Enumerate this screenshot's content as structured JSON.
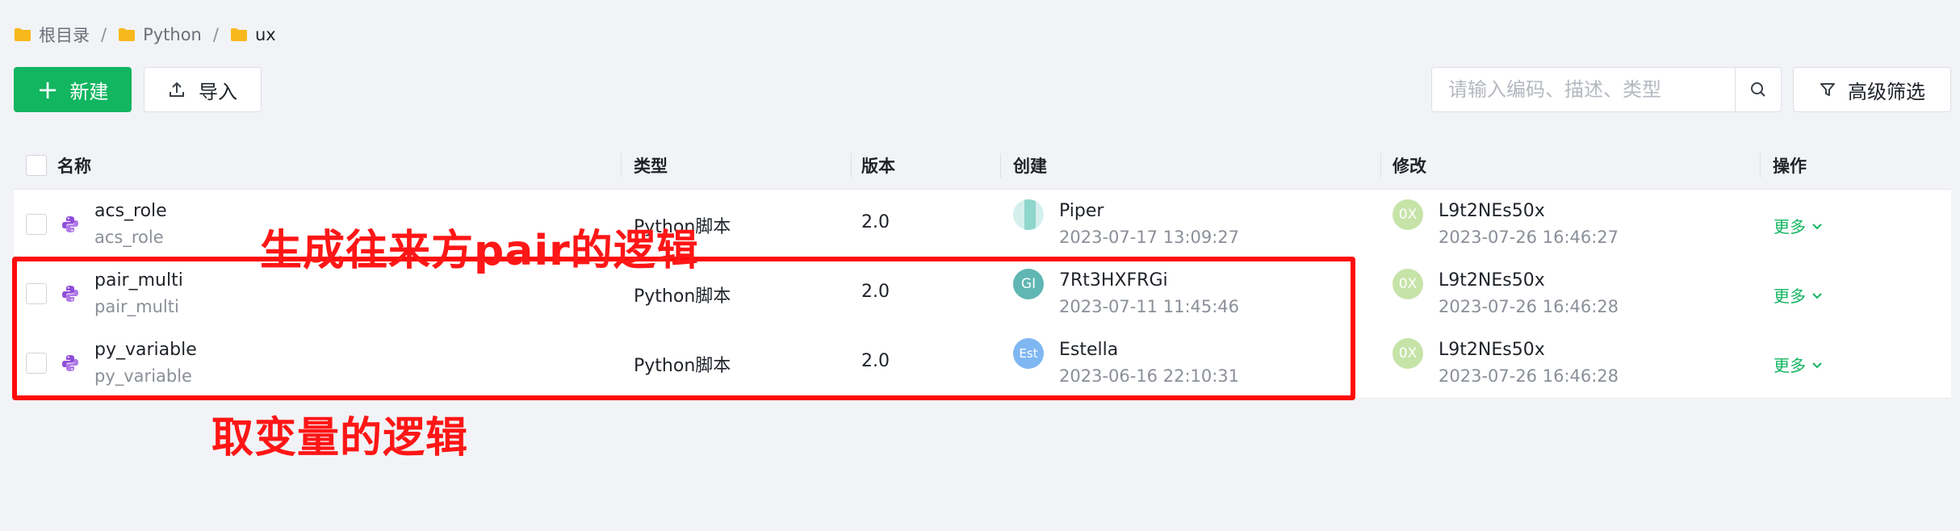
{
  "breadcrumb": [
    {
      "label": "根目录"
    },
    {
      "label": "Python"
    },
    {
      "label": "ux"
    }
  ],
  "toolbar": {
    "new_label": "新建",
    "import_label": "导入",
    "search_placeholder": "请输入编码、描述、类型",
    "filter_label": "高级筛选"
  },
  "table": {
    "columns": [
      "名称",
      "类型",
      "版本",
      "创建",
      "修改",
      "操作"
    ],
    "rows": [
      {
        "name": "acs_role",
        "code": "acs_role",
        "type": "Python脚本",
        "version": "2.0",
        "creator": "Piper",
        "created": "2023-07-17 13:09:27",
        "creator_avatar": "",
        "modifier": "L9t2NEs50x",
        "modified": "2023-07-26 16:46:27",
        "modifier_avatar": "0X",
        "action": "更多"
      },
      {
        "name": "pair_multi",
        "code": "pair_multi",
        "type": "Python脚本",
        "version": "2.0",
        "creator": "7Rt3HXFRGi",
        "created": "2023-07-11 11:45:46",
        "creator_avatar": "GI",
        "modifier": "L9t2NEs50x",
        "modified": "2023-07-26 16:46:28",
        "modifier_avatar": "0X",
        "action": "更多"
      },
      {
        "name": "py_variable",
        "code": "py_variable",
        "type": "Python脚本",
        "version": "2.0",
        "creator": "Estella",
        "created": "2023-06-16 22:10:31",
        "creator_avatar": "Est",
        "modifier": "L9t2NEs50x",
        "modified": "2023-07-26 16:46:28",
        "modifier_avatar": "0X",
        "action": "更多"
      }
    ]
  },
  "annotations": {
    "top": "生成往来方pair的逻辑",
    "bottom": "取变量的逻辑"
  },
  "colors": {
    "primary": "#12b560",
    "annotation": "#ff1616",
    "python_icon": "#8f4ed8",
    "avatar_modifier": "#c6e3a8",
    "avatar_gi": "#5fb6b2",
    "avatar_est": "#7fb7f2"
  }
}
